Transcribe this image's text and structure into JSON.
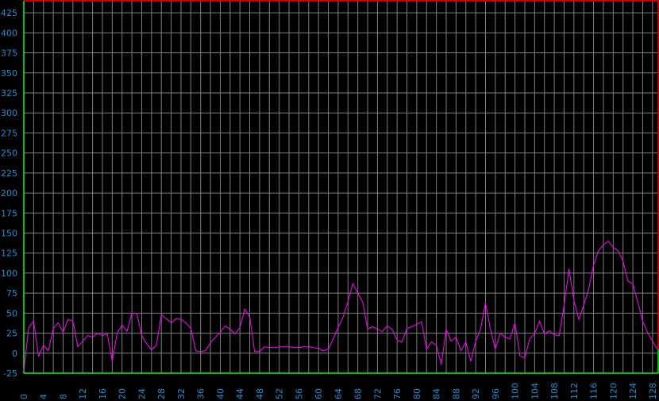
{
  "chart_data": {
    "type": "line",
    "title": "",
    "xlabel": "",
    "ylabel": "",
    "xlim": [
      0,
      129
    ],
    "ylim": [
      -25,
      440
    ],
    "x_ticks": [
      0,
      4,
      8,
      12,
      16,
      20,
      24,
      28,
      32,
      36,
      40,
      44,
      48,
      52,
      56,
      60,
      64,
      68,
      72,
      76,
      80,
      84,
      88,
      92,
      96,
      100,
      104,
      108,
      112,
      116,
      120,
      124,
      128
    ],
    "y_ticks": [
      -25,
      0,
      25,
      50,
      75,
      100,
      125,
      150,
      175,
      200,
      225,
      250,
      275,
      300,
      325,
      350,
      375,
      400,
      425
    ],
    "x_tick_labels": [
      "0",
      "4",
      "8",
      "12",
      "16",
      "20",
      "24",
      "28",
      "32",
      "36",
      "40",
      "44",
      "48",
      "52",
      "56",
      "60",
      "64",
      "68",
      "72",
      "76",
      "80",
      "84",
      "88",
      "92",
      "96",
      "100",
      "104",
      "108",
      "112",
      "116",
      "120",
      "124",
      "128"
    ],
    "y_tick_labels": [
      "-25",
      "0",
      "25",
      "50",
      "75",
      "100",
      "125",
      "150",
      "175",
      "200",
      "225",
      "250",
      "275",
      "300",
      "325",
      "350",
      "375",
      "400",
      "425"
    ],
    "grid": true,
    "colors": {
      "background": "#000000",
      "grid": "#7f7f7f",
      "line": "#ff00ff",
      "tick_label": "#1e8fd2",
      "top_border": "#ff0000",
      "baseline": "#00ff00"
    },
    "series": [
      {
        "values": [
          -22,
          32,
          40,
          -4,
          10,
          3,
          31,
          38,
          26,
          42,
          40,
          8,
          15,
          22,
          20,
          25,
          22,
          24,
          -10,
          25,
          35,
          27,
          50,
          50,
          22,
          12,
          4,
          10,
          48,
          43,
          38,
          43,
          42,
          38,
          31,
          3,
          2,
          3,
          13,
          20,
          26,
          34,
          30,
          24,
          32,
          55,
          45,
          2,
          2,
          8,
          7,
          7,
          8,
          8,
          8,
          7,
          7,
          8,
          8,
          7,
          6,
          3,
          5,
          18,
          32,
          45,
          65,
          87,
          75,
          64,
          30,
          33,
          30,
          27,
          34,
          30,
          16,
          14,
          31,
          33,
          36,
          39,
          5,
          14,
          10,
          -14,
          30,
          15,
          20,
          3,
          14,
          -10,
          15,
          30,
          63,
          30,
          5,
          25,
          20,
          18,
          38,
          -3,
          -6,
          18,
          24,
          40,
          24,
          28,
          23,
          22,
          60,
          105,
          66,
          42,
          60,
          80,
          110,
          128,
          135,
          140,
          132,
          128,
          115,
          90,
          87,
          64,
          40,
          26,
          15,
          5
        ]
      }
    ]
  }
}
